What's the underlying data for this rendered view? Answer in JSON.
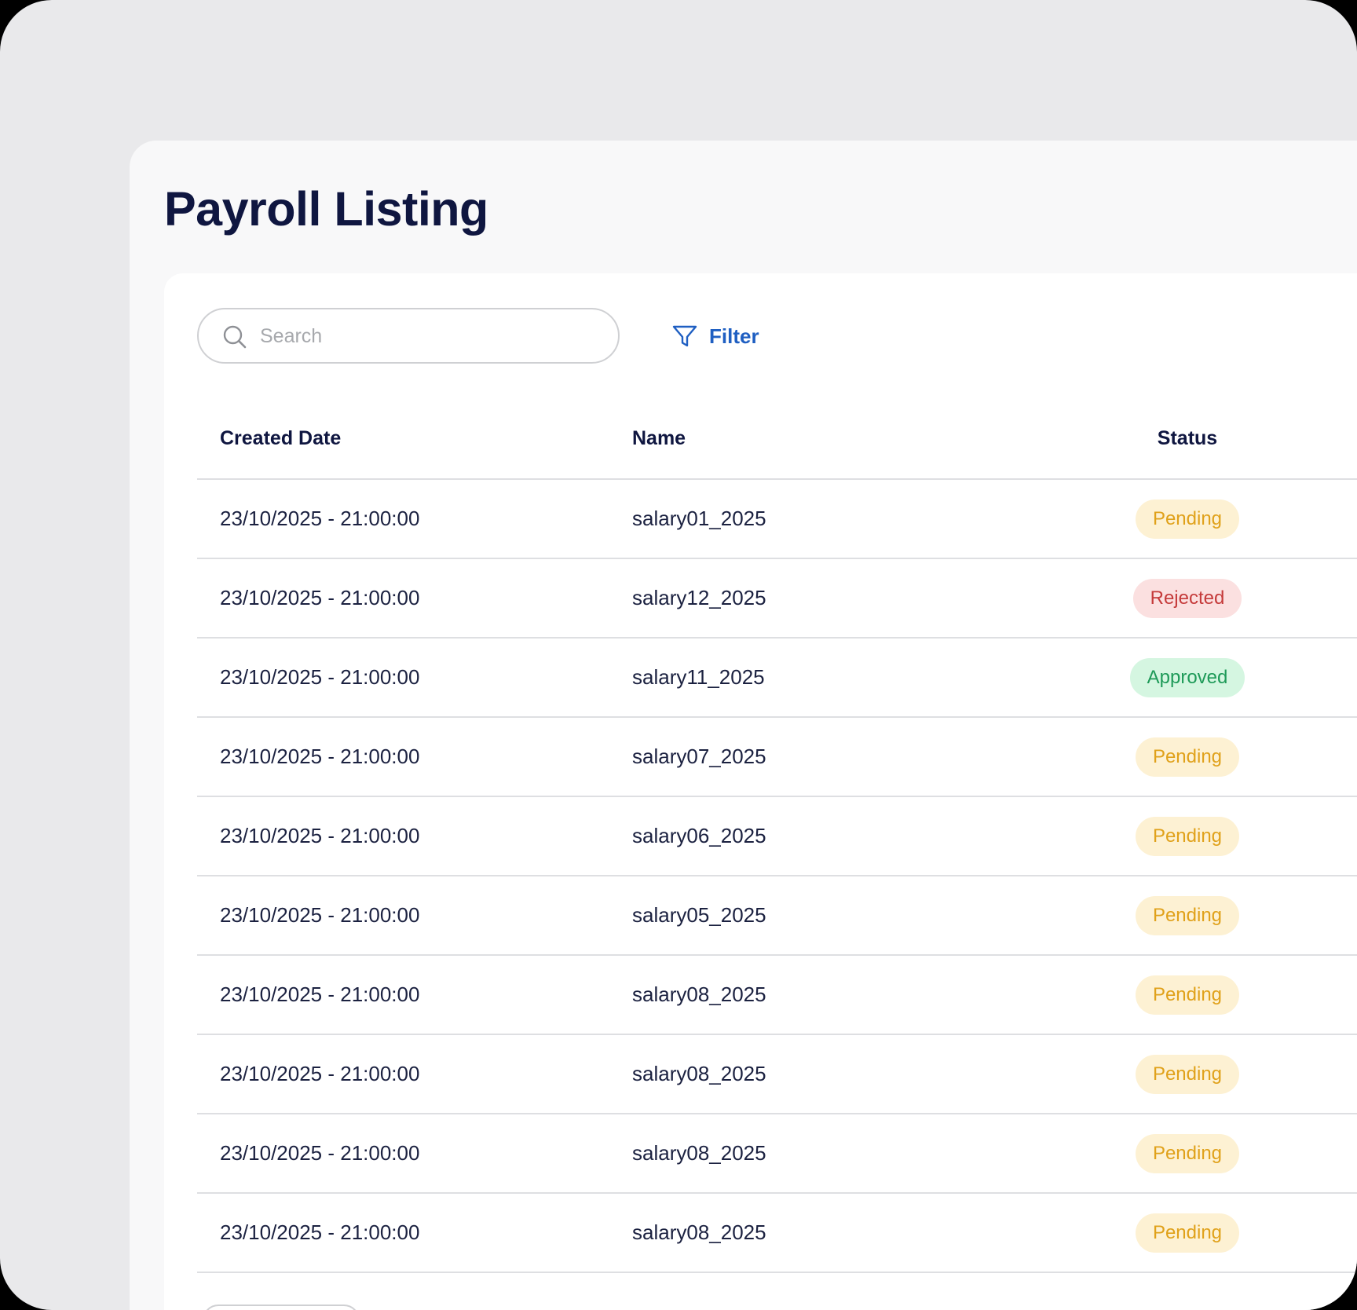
{
  "page": {
    "title": "Payroll Listing"
  },
  "toolbar": {
    "search_placeholder": "Search",
    "search_value": "",
    "filter_label": "Filter"
  },
  "table": {
    "columns": [
      "Created Date",
      "Name",
      "Status"
    ],
    "rows": [
      {
        "created": "23/10/2025 - 21:00:00",
        "name": "salary01_2025",
        "status": "Pending",
        "status_kind": "pending"
      },
      {
        "created": "23/10/2025 - 21:00:00",
        "name": "salary12_2025",
        "status": "Rejected",
        "status_kind": "rejected"
      },
      {
        "created": "23/10/2025 - 21:00:00",
        "name": "salary11_2025",
        "status": "Approved",
        "status_kind": "approved"
      },
      {
        "created": "23/10/2025 - 21:00:00",
        "name": "salary07_2025",
        "status": "Pending",
        "status_kind": "pending"
      },
      {
        "created": "23/10/2025 - 21:00:00",
        "name": "salary06_2025",
        "status": "Pending",
        "status_kind": "pending"
      },
      {
        "created": "23/10/2025 - 21:00:00",
        "name": "salary05_2025",
        "status": "Pending",
        "status_kind": "pending"
      },
      {
        "created": "23/10/2025 - 21:00:00",
        "name": "salary08_2025",
        "status": "Pending",
        "status_kind": "pending"
      },
      {
        "created": "23/10/2025 - 21:00:00",
        "name": "salary08_2025",
        "status": "Pending",
        "status_kind": "pending"
      },
      {
        "created": "23/10/2025 - 21:00:00",
        "name": "salary08_2025",
        "status": "Pending",
        "status_kind": "pending"
      },
      {
        "created": "23/10/2025 - 21:00:00",
        "name": "salary08_2025",
        "status": "Pending",
        "status_kind": "pending"
      }
    ]
  },
  "icons": {
    "search": "search-icon",
    "filter": "filter-icon"
  },
  "colors": {
    "title": "#0f1640",
    "accent": "#1f5fc2",
    "pending_bg": "#fdf1d3",
    "pending_text": "#e0a11a",
    "rejected_bg": "#fbe0e0",
    "rejected_text": "#c53a3a",
    "approved_bg": "#d5f6e1",
    "approved_text": "#1e9a58"
  }
}
